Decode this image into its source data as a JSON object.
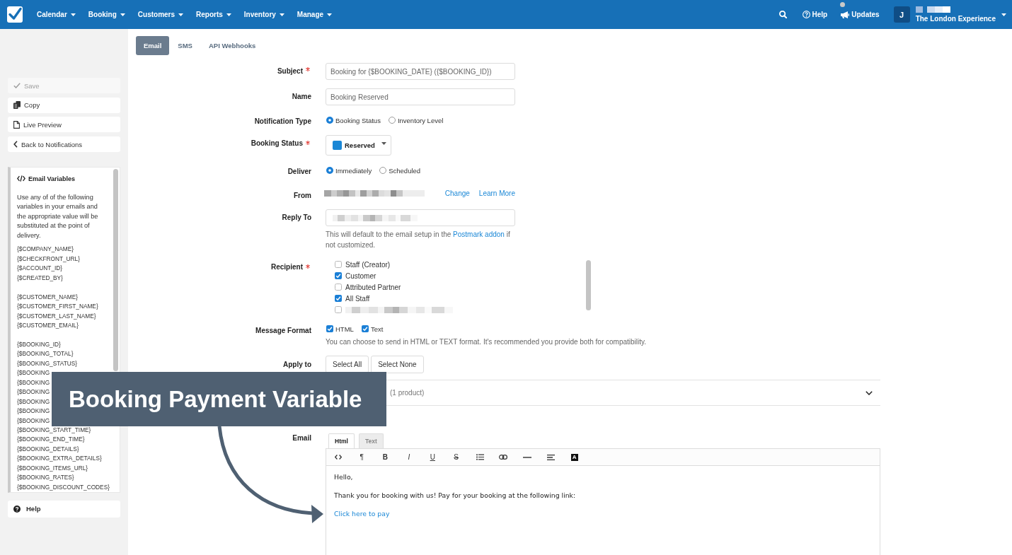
{
  "top_bar": {
    "menu": [
      {
        "label": "Calendar"
      },
      {
        "label": "Booking"
      },
      {
        "label": "Customers"
      },
      {
        "label": "Reports"
      },
      {
        "label": "Inventory"
      },
      {
        "label": "Manage"
      }
    ],
    "actions": [
      {
        "kind": "search"
      },
      {
        "kind": "help",
        "label": "Help"
      },
      {
        "kind": "updates",
        "label": "Updates",
        "unread": true
      }
    ],
    "account": {
      "initial": "J",
      "user_blurred": true,
      "name": "The London Experience"
    }
  },
  "sidebar": {
    "buttons": [
      {
        "kind": "save",
        "label": "Save",
        "disabled": true
      },
      {
        "kind": "copy",
        "label": "Copy",
        "disabled": false
      },
      {
        "kind": "preview",
        "label": "Live Preview",
        "disabled": false
      },
      {
        "kind": "back",
        "label": "Back to Notifications",
        "disabled": false
      }
    ],
    "variables_panel": {
      "title": "Email Variables",
      "intro": "Use any of of the following variables in your emails and the appropriate value will be substituted at the point of delivery.",
      "groups": [
        [
          "{$COMPANY_NAME}",
          "{$CHECKFRONT_URL}",
          "{$ACCOUNT_ID}",
          "{$CREATED_BY}"
        ],
        [
          "{$CUSTOMER_NAME}",
          "{$CUSTOMER_FIRST_NAME}",
          "{$CUSTOMER_LAST_NAME}",
          "{$CUSTOMER_EMAIL}"
        ],
        [
          "{$BOOKING_ID}",
          "{$BOOKING_TOTAL}",
          "{$BOOKING_STATUS}",
          "{$BOOKING",
          "{$BOOKING",
          "{$BOOKING",
          "{$BOOKING",
          "{$BOOKING",
          "{$BOOKING",
          "{$BOOKING_START_TIME}",
          "{$BOOKING_END_TIME}",
          "{$BOOKING_DETAILS}",
          "{$BOOKING_EXTRA_DETAILS}",
          "{$BOOKING_ITEMS_URL}",
          "{$BOOKING_RATES}",
          "{$BOOKING_DISCOUNT_CODES}"
        ]
      ]
    },
    "help_button": {
      "label": "Help"
    }
  },
  "tabs": [
    {
      "label": "Email",
      "selected": true
    },
    {
      "label": "SMS",
      "selected": false
    },
    {
      "label": "API Webhooks",
      "selected": false
    }
  ],
  "form": {
    "fields": [
      {
        "kind": "text",
        "label": "Subject",
        "required": true,
        "value": "Booking for {$BOOKING_DATE} ({$BOOKING_ID})"
      },
      {
        "kind": "text",
        "label": "Name",
        "required": false,
        "value": "Booking Reserved"
      },
      {
        "kind": "radio",
        "label": "Notification Type",
        "required": false,
        "options": [
          {
            "label": "Booking Status",
            "selected": true
          },
          {
            "label": "Inventory Level",
            "selected": false
          }
        ]
      },
      {
        "kind": "select",
        "label": "Booking Status",
        "required": true,
        "value": "Reserved",
        "color": "#1a87d6"
      },
      {
        "kind": "radio",
        "label": "Deliver",
        "required": false,
        "options": [
          {
            "label": "Immediately",
            "selected": true
          },
          {
            "label": "Scheduled",
            "selected": false
          }
        ]
      },
      {
        "kind": "sender",
        "label": "From",
        "required": false,
        "blurred": true,
        "links": [
          "Change",
          "Learn More"
        ]
      },
      {
        "kind": "text",
        "label": "Reply To",
        "required": false,
        "blurred": true,
        "help": {
          "before": "This will default to the email setup in the",
          "link": "Postmark addon",
          "after": "if not customized."
        }
      },
      {
        "kind": "checklist",
        "label": "Recipient",
        "required": true,
        "options": [
          {
            "label": "Staff (Creator)",
            "checked": false
          },
          {
            "label": "Customer",
            "checked": true
          },
          {
            "label": "Attributed Partner",
            "checked": false
          },
          {
            "label": "All Staff",
            "checked": true
          },
          {
            "blurred": true,
            "checked": false
          }
        ]
      },
      {
        "kind": "checks",
        "label": "Message Format",
        "required": false,
        "options": [
          {
            "label": "HTML",
            "checked": true
          },
          {
            "label": "Text",
            "checked": true
          }
        ],
        "help": "You can choose to send in HTML or TEXT format. It's recommended you provide both for compatibility."
      },
      {
        "kind": "buttons",
        "label": "Apply to",
        "required": false,
        "buttons": [
          "Select All",
          "Select None"
        ]
      },
      {
        "kind": "product",
        "count": "(1 product)",
        "expanded": false
      },
      {
        "kind": "editor",
        "label": "Email",
        "required": false,
        "tabs": [
          {
            "label": "Html",
            "selected": true
          },
          {
            "label": "Text",
            "selected": false
          }
        ],
        "toolbar": [
          {
            "kind": "code"
          },
          {
            "kind": "paragraph",
            "label": "¶"
          },
          {
            "kind": "bold",
            "label": "B"
          },
          {
            "kind": "italic",
            "label": "I"
          },
          {
            "kind": "underline",
            "label": "U"
          },
          {
            "kind": "strike",
            "label": "S"
          },
          {
            "kind": "list"
          },
          {
            "kind": "link"
          },
          {
            "kind": "rule"
          },
          {
            "kind": "align"
          },
          {
            "kind": "color",
            "label": "A"
          }
        ],
        "body": [
          {
            "kind": "text",
            "text": "Hello,"
          },
          {
            "kind": "text",
            "text": "Thank you for booking with us! Pay for your booking at the following link:"
          },
          {
            "kind": "link",
            "text": "Click here to pay"
          }
        ]
      }
    ]
  },
  "callout": {
    "text": "Booking Payment Variable"
  }
}
